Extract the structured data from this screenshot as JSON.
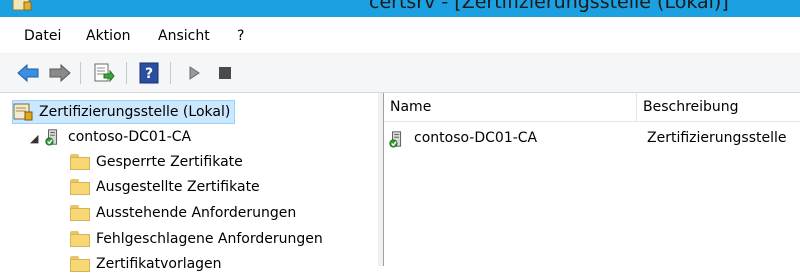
{
  "window": {
    "title": "certsrv - [Zertifizierungsstelle (Lokal)]",
    "title_bar_color": "#1ba1e2"
  },
  "menu": {
    "items": [
      {
        "label": "Datei"
      },
      {
        "label": "Aktion"
      },
      {
        "label": "Ansicht"
      },
      {
        "label": "?"
      }
    ]
  },
  "toolbar": {
    "buttons": [
      {
        "icon": "back-arrow-icon"
      },
      {
        "icon": "forward-arrow-icon"
      },
      {
        "icon": "export-list-icon"
      },
      {
        "icon": "help-icon"
      },
      {
        "icon": "play-icon"
      },
      {
        "icon": "stop-icon"
      }
    ]
  },
  "tree": {
    "root": {
      "label": "Zertifizierungsstelle (Lokal)",
      "icon": "certificate-authority-icon"
    },
    "ca": {
      "label": "contoso-DC01-CA",
      "icon": "ca-server-icon"
    },
    "folders": [
      {
        "label": "Gesperrte Zertifikate"
      },
      {
        "label": "Ausgestellte Zertifikate"
      },
      {
        "label": "Ausstehende Anforderungen"
      },
      {
        "label": "Fehlgeschlagene Anforderungen"
      },
      {
        "label": "Zertifikatvorlagen"
      }
    ]
  },
  "list": {
    "columns": [
      {
        "label": "Name"
      },
      {
        "label": "Beschreibung"
      }
    ],
    "rows": [
      {
        "name": "contoso-DC01-CA",
        "description": "Zertifizierungsstelle"
      }
    ]
  }
}
